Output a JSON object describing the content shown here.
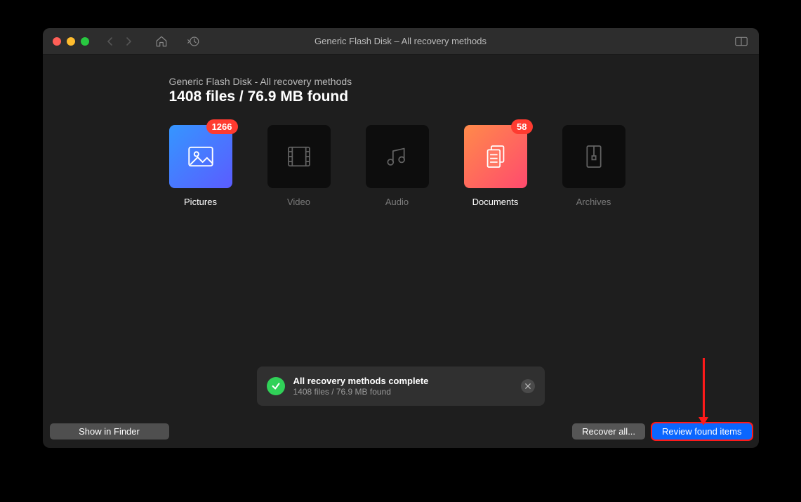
{
  "titlebar": {
    "title": "Generic Flash Disk – All recovery methods"
  },
  "header": {
    "breadcrumb": "Generic Flash Disk - All recovery methods",
    "heading": "1408 files / 76.9 MB found"
  },
  "categories": [
    {
      "key": "pictures",
      "label": "Pictures",
      "badge": "1266",
      "active": true
    },
    {
      "key": "video",
      "label": "Video",
      "badge": null,
      "active": false
    },
    {
      "key": "audio",
      "label": "Audio",
      "badge": null,
      "active": false
    },
    {
      "key": "documents",
      "label": "Documents",
      "badge": "58",
      "active": true
    },
    {
      "key": "archives",
      "label": "Archives",
      "badge": null,
      "active": false
    }
  ],
  "toast": {
    "title": "All recovery methods complete",
    "subtitle": "1408 files / 76.9 MB found"
  },
  "footer": {
    "show_in_finder": "Show in Finder",
    "recover_all": "Recover all...",
    "review": "Review found items"
  }
}
